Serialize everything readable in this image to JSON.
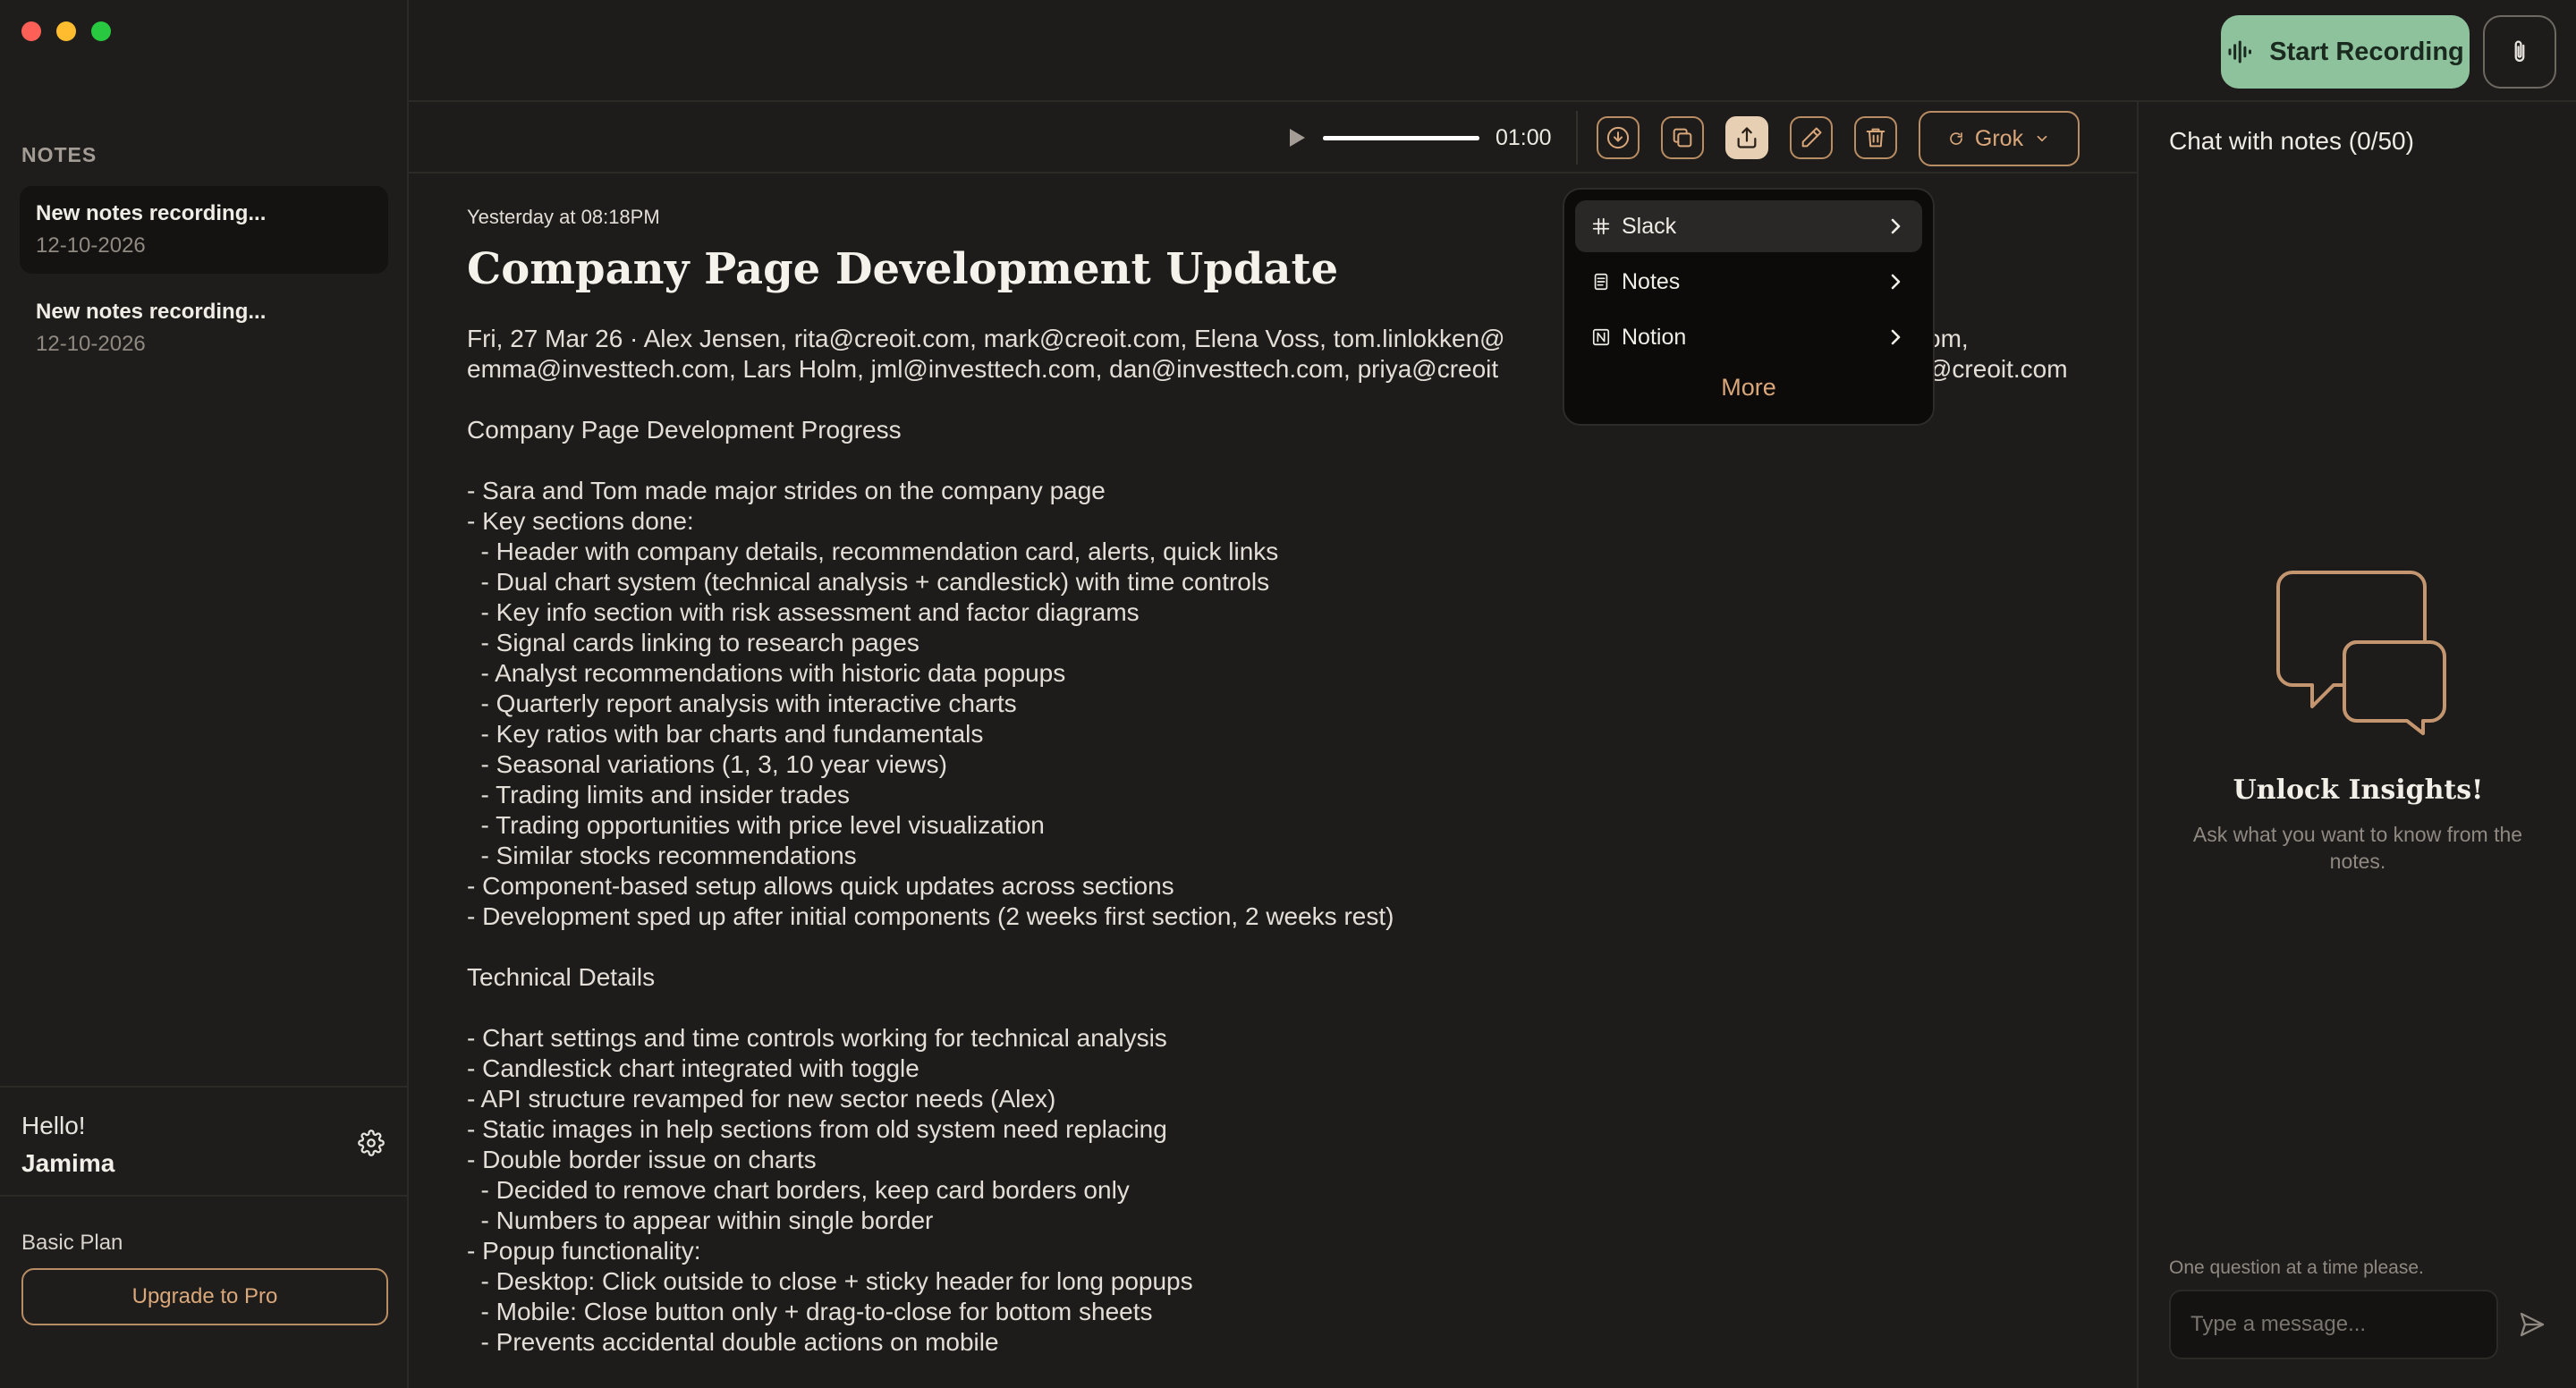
{
  "sidebar": {
    "heading": "NOTES",
    "notes": [
      {
        "title": "New notes recording...",
        "date": "12-10-2026"
      },
      {
        "title": "New notes recording...",
        "date": "12-10-2026"
      }
    ],
    "greeting": "Hello!",
    "username": "Jamima",
    "plan": "Basic Plan",
    "upgrade_label": "Upgrade to Pro"
  },
  "topbar": {
    "start_recording_label": "Start Recording"
  },
  "player": {
    "time": "01:00",
    "progress": 1.0
  },
  "toolbar": {
    "model_label": "Grok"
  },
  "export_menu": {
    "items": [
      {
        "label": "Slack",
        "icon": "slack-icon"
      },
      {
        "label": "Notes",
        "icon": "notes-icon"
      },
      {
        "label": "Notion",
        "icon": "notion-icon"
      }
    ],
    "more_label": "More"
  },
  "note": {
    "timestamp": "Yesterday at 08:18PM",
    "title": "Company Page Development Update",
    "attendees_line1": "Fri, 27 Mar 26 · Alex Jensen, rita@creoit.com, mark@creoit.com, Elena Voss, tom.linlokken@",
    "attendees_line1_end": "om,",
    "attendees_line2": "emma@investtech.com, Lars Holm, jml@investtech.com, dan@investtech.com, priya@creoit",
    "attendees_line2_end": "@creoit.com",
    "lines": [
      "Company Page Development Progress",
      "",
      "- Sara and Tom made major strides on the company page",
      "- Key sections done:",
      "  - Header with company details, recommendation card, alerts, quick links",
      "  - Dual chart system (technical analysis + candlestick) with time controls",
      "  - Key info section with risk assessment and factor diagrams",
      "  - Signal cards linking to research pages",
      "  - Analyst recommendations with historic data popups",
      "  - Quarterly report analysis with interactive charts",
      "  - Key ratios with bar charts and fundamentals",
      "  - Seasonal variations (1, 3, 10 year views)",
      "  - Trading limits and insider trades",
      "  - Trading opportunities with price level visualization",
      "  - Similar stocks recommendations",
      "- Component-based setup allows quick updates across sections",
      "- Development sped up after initial components (2 weeks first section, 2 weeks rest)",
      "",
      "Technical Details",
      "",
      "- Chart settings and time controls working for technical analysis",
      "- Candlestick chart integrated with toggle",
      "- API structure revamped for new sector needs (Alex)",
      "- Static images in help sections from old system need replacing",
      "- Double border issue on charts",
      "  - Decided to remove chart borders, keep card borders only",
      "  - Numbers to appear within single border",
      "- Popup functionality:",
      "  - Desktop: Click outside to close + sticky header for long popups",
      "  - Mobile: Close button only + drag-to-close for bottom sheets",
      "  - Prevents accidental double actions on mobile"
    ]
  },
  "chat": {
    "title": "Chat with notes",
    "count": "(0/50)",
    "empty_title": "Unlock Insights!",
    "empty_subtitle": "Ask what you want to know from the notes.",
    "hint": "One question at a time please.",
    "input_placeholder": "Type a message..."
  },
  "colors": {
    "accent": "#b98d63",
    "accent_text": "#d9a77a",
    "record_button": "#8ec29d",
    "background": "#1e1c1a"
  }
}
